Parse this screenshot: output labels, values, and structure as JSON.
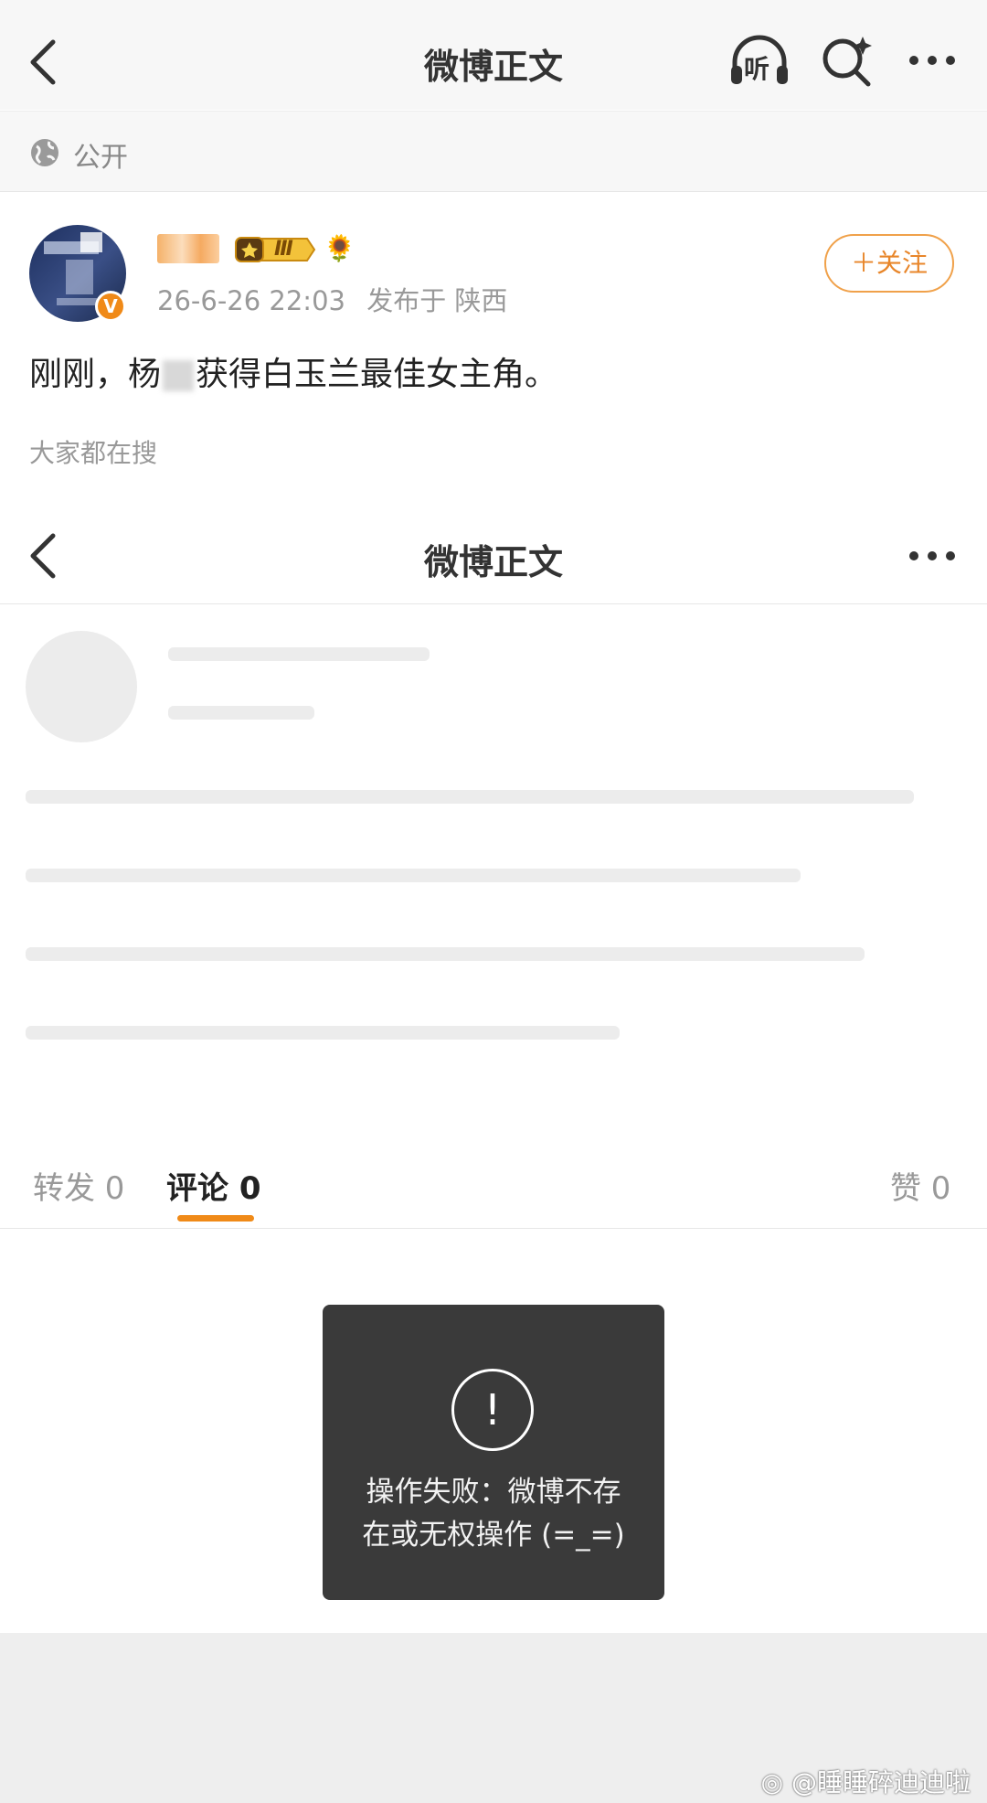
{
  "header": {
    "title": "微博正文",
    "listen_label": "听"
  },
  "visibility": {
    "label": "公开"
  },
  "post": {
    "author_level": "Ⅲ",
    "time": "26-6-26 22:03",
    "location": "发布于 陕西",
    "follow_label": "＋关注",
    "verified_badge": "V",
    "text_before": "刚刚，杨",
    "text_after": "获得白玉兰最佳女主角。",
    "search_hint": "大家都在搜"
  },
  "header2": {
    "title": "微博正文"
  },
  "tabs": {
    "repost": "转发 0",
    "comment": "评论 0",
    "like": "赞 0"
  },
  "toast": {
    "icon": "!",
    "line1": "操作失败：微博不存",
    "line2": "在或无权操作 (=_=)"
  },
  "watermark": "@睡睡碎迪迪啦",
  "colors": {
    "accent": "#f08a18",
    "follow_border": "#f0a14a",
    "toast_bg": "#3a3a3a"
  }
}
